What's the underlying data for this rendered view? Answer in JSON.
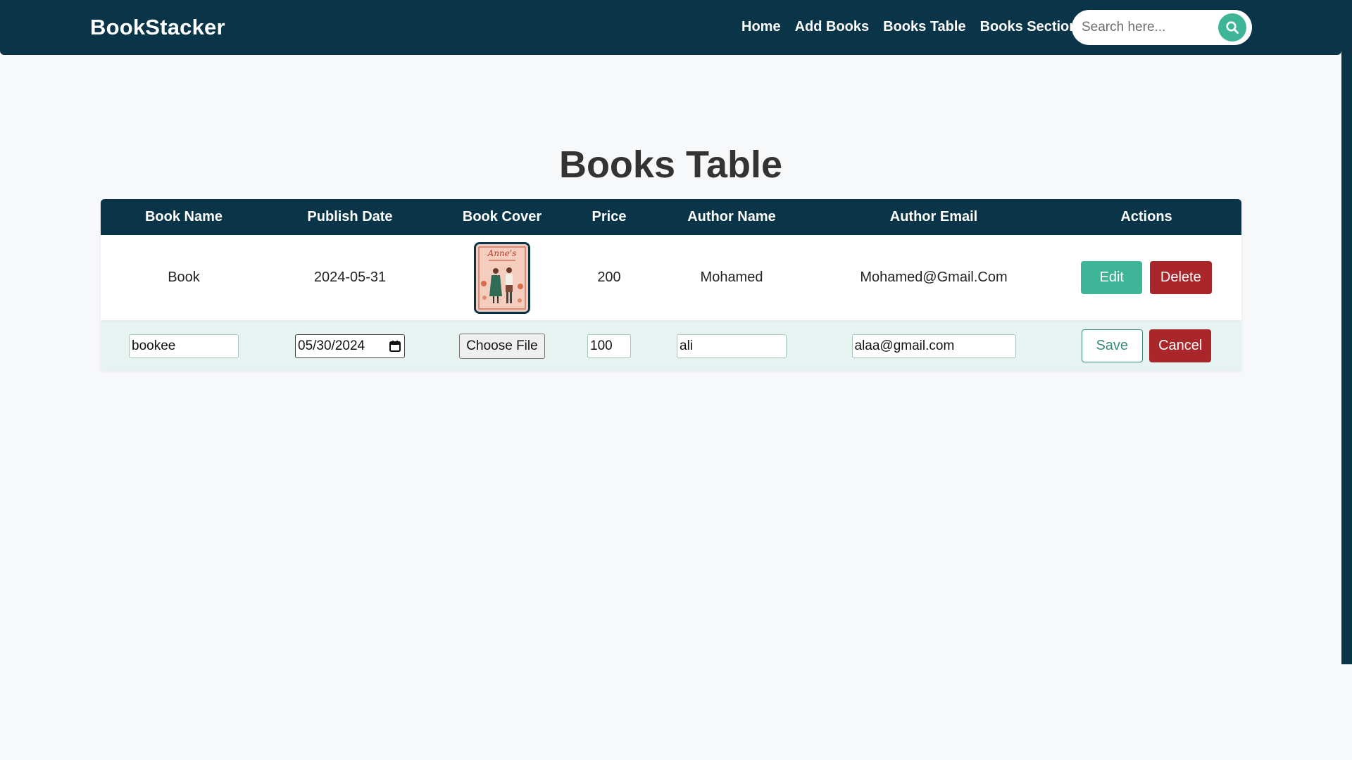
{
  "nav": {
    "brand": "BookStacker",
    "links": [
      "Home",
      "Add Books",
      "Books Table",
      "Books Section"
    ],
    "search_placeholder": "Search here..."
  },
  "page_title": "Books Table",
  "table": {
    "headers": [
      "Book Name",
      "Publish Date",
      "Book Cover",
      "Price",
      "Author Name",
      "Author Email",
      "Actions"
    ],
    "row": {
      "book_name": "Book",
      "publish_date": "2024-05-31",
      "cover_icon": "book-cover-image",
      "price": "200",
      "author_name": "Mohamed",
      "author_email": "Mohamed@Gmail.Com",
      "edit_label": "Edit",
      "delete_label": "Delete"
    },
    "edit_row": {
      "book_name": "bookee",
      "publish_date": "05/30/2024",
      "file_label": "Choose File",
      "price": "100",
      "author_name": "ali",
      "author_email": "alaa@gmail.com",
      "save_label": "Save",
      "cancel_label": "Cancel"
    }
  },
  "colors": {
    "navy": "#0a3549",
    "teal": "#3fb597",
    "danger": "#a9262b"
  }
}
